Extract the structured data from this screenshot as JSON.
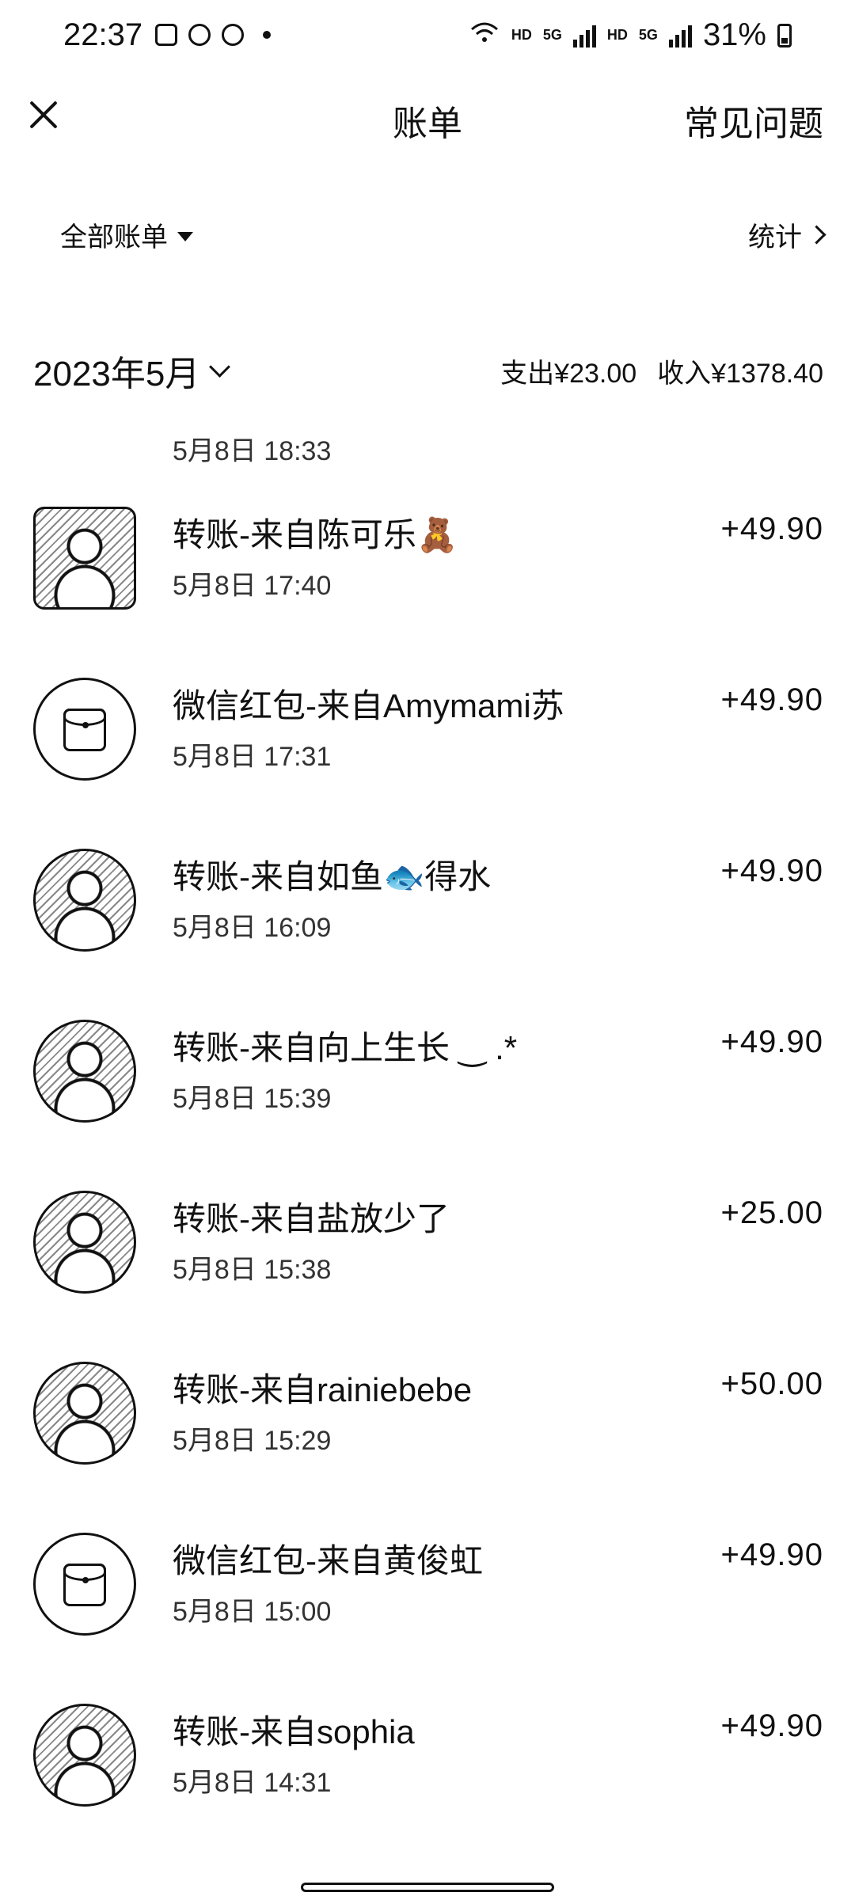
{
  "status_bar": {
    "time": "22:37",
    "network_label": "HD",
    "network_type": "5G",
    "battery": "31%"
  },
  "header": {
    "title": "账单",
    "faq": "常见问题"
  },
  "filter": {
    "all_bills": "全部账单",
    "stats": "统计"
  },
  "month": {
    "label": "2023年5月",
    "expense": "支出¥23.00",
    "income": "收入¥1378.40"
  },
  "partial_time": "5月8日 18:33",
  "transactions": [
    {
      "title": "转账-来自陈可乐🧸",
      "time": "5月8日 17:40",
      "amount": "+49.90",
      "avatar": "photo"
    },
    {
      "title": "微信红包-来自Amymami苏",
      "time": "5月8日 17:31",
      "amount": "+49.90",
      "avatar": "red-packet"
    },
    {
      "title": "转账-来自如鱼🐟得水",
      "time": "5月8日 16:09",
      "amount": "+49.90",
      "avatar": "photo"
    },
    {
      "title": "转账-来自向上生长 ‿ .*",
      "time": "5月8日 15:39",
      "amount": "+49.90",
      "avatar": "photo"
    },
    {
      "title": "转账-来自盐放少了",
      "time": "5月8日 15:38",
      "amount": "+25.00",
      "avatar": "photo"
    },
    {
      "title": "转账-来自rainiebebe",
      "time": "5月8日 15:29",
      "amount": "+50.00",
      "avatar": "photo"
    },
    {
      "title": "微信红包-来自黄俊虹",
      "time": "5月8日 15:00",
      "amount": "+49.90",
      "avatar": "red-packet"
    },
    {
      "title": "转账-来自sophia",
      "time": "5月8日 14:31",
      "amount": "+49.90",
      "avatar": "photo"
    }
  ]
}
